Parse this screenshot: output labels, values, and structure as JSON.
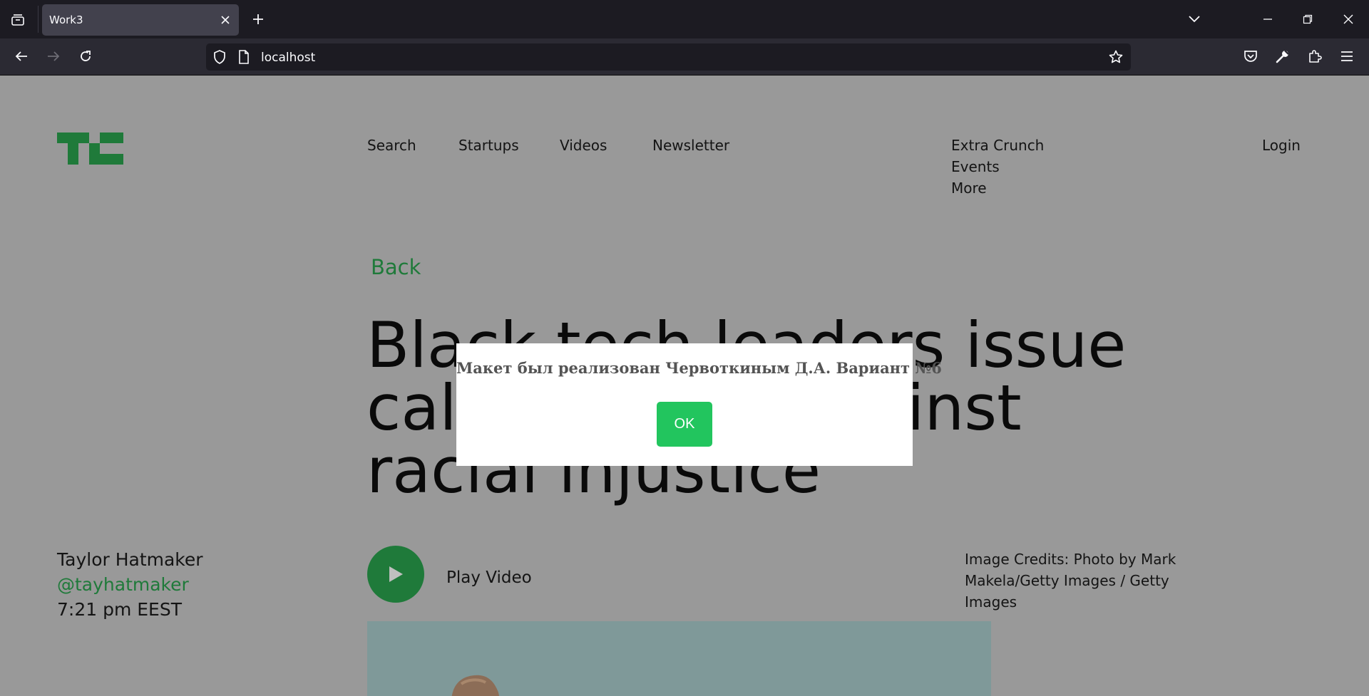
{
  "browser": {
    "tab_title": "Work3",
    "url": "localhost",
    "icons": {
      "tab_list": "tab-list-icon",
      "close_tab": "close-icon",
      "new_tab": "plus-icon",
      "list_all_tabs": "chevron-down-icon",
      "minimize": "minimize-icon",
      "restore": "restore-icon",
      "close_window": "close-icon",
      "back": "arrow-left-icon",
      "forward": "arrow-right-icon",
      "reload": "reload-icon",
      "tracking_protection": "shield-icon",
      "page_info": "page-icon",
      "bookmark": "star-icon",
      "pocket": "pocket-icon",
      "devtools": "wrench-icon",
      "extensions": "puzzle-icon",
      "menu": "hamburger-icon"
    }
  },
  "site": {
    "nav": [
      "Search",
      "Startups",
      "Videos",
      "Newsletter"
    ],
    "nav_more": [
      "Extra Crunch",
      "Events",
      "More"
    ],
    "login": "Login",
    "back": "Back",
    "headline_lines": [
      "Black tech leaders issue",
      "call to action against",
      "racial injustice"
    ],
    "author": {
      "name": "Taylor Hatmaker",
      "handle": "@tayhatmaker",
      "time": "7:21 pm EEST"
    },
    "play_video": "Play Video",
    "image_credits": "Image Credits: Photo by Mark Makela/Getty Images / Getty Images",
    "colors": {
      "accent": "#1f7a3a",
      "overlay_bg": "#999999"
    }
  },
  "modal": {
    "message": "Макет был реализован Червоткиным Д.А. Вариант №6",
    "ok_label": "OK",
    "ok_color": "#22c55e"
  }
}
